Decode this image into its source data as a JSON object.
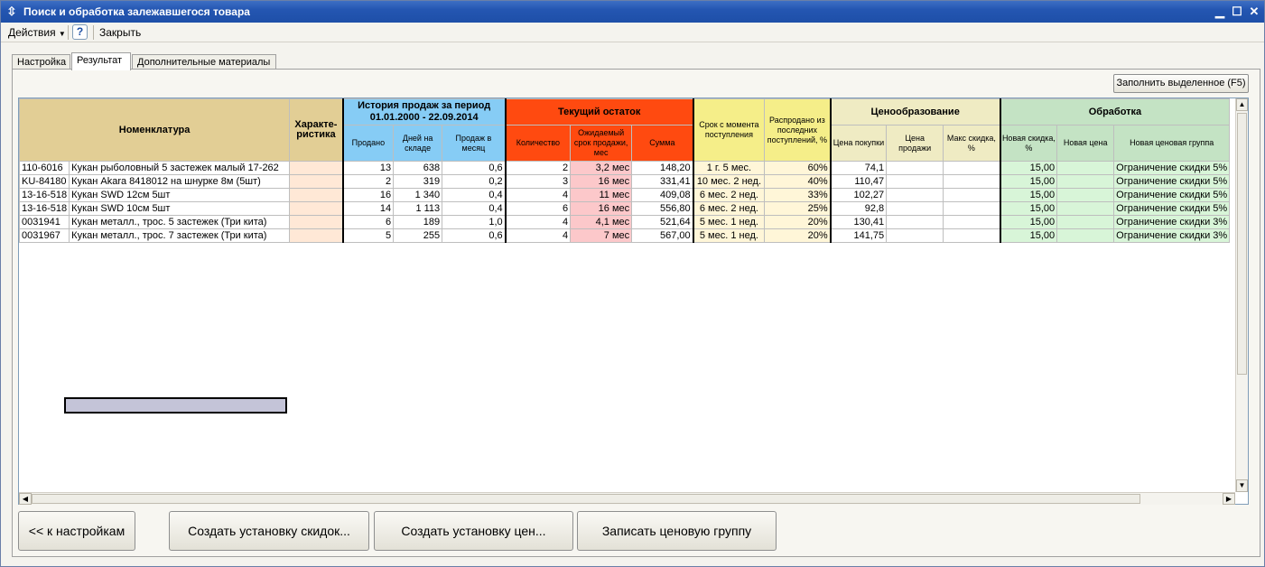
{
  "window": {
    "title": "Поиск и обработка залежавшегося товара"
  },
  "menu": {
    "actions": "Действия",
    "help": "?",
    "close": "Закрыть"
  },
  "tabs": [
    "Настройка",
    "Результат",
    "Дополнительные материалы"
  ],
  "fill_selected_button": "Заполнить выделенное (F5)",
  "table": {
    "group_headers": {
      "nomenclature": "Номенклатура",
      "characteristic": "Характе-\nристика",
      "history": "История продаж за период\n01.01.2000 - 22.09.2014",
      "stock": "Текущий остаток",
      "age": "Срок с момента поступления",
      "sold_percent": "Распродано из последних поступлений, %",
      "pricing": "Ценообразование",
      "processing": "Обработка"
    },
    "sub_headers": {
      "sold": "Продано",
      "days_in_stock": "Дней на складе",
      "sales_per_month": "Продаж в месяц",
      "quantity": "Количество",
      "expected_term": "Ожидаемый срок продажи, мес",
      "sum": "Сумма",
      "purchase_price": "Цена покупки",
      "sale_price": "Цена продажи",
      "max_discount": "Макс скидка, %",
      "new_discount": "Новая скидка, %",
      "new_price": "Новая цена",
      "new_price_group": "Новая ценовая группа"
    },
    "rows": [
      {
        "code": "110-6016",
        "name": "Кукан рыболовный 5 застежек малый 17-262",
        "char": "",
        "sold": "13",
        "days": "638",
        "per_month": "0,6",
        "qty": "2",
        "expected": "3,2 мес",
        "sum": "148,20",
        "age": "1 г. 5 мес.",
        "sold_pct": "60%",
        "purchase": "74,1",
        "sale": "",
        "max_disc": "",
        "new_disc": "15,00",
        "new_price": "",
        "group": "Ограничение скидки 5%"
      },
      {
        "code": "KU-84180",
        "name": "Кукан Akara 8418012 на шнурке 8м (5шт)",
        "char": "",
        "sold": "2",
        "days": "319",
        "per_month": "0,2",
        "qty": "3",
        "expected": "16 мес",
        "sum": "331,41",
        "age": "10 мес. 2 нед.",
        "sold_pct": "40%",
        "purchase": "110,47",
        "sale": "",
        "max_disc": "",
        "new_disc": "15,00",
        "new_price": "",
        "group": "Ограничение скидки 5%"
      },
      {
        "code": "13-16-518",
        "name": "Кукан SWD 12см 5шт",
        "char": "",
        "sold": "16",
        "days": "1 340",
        "per_month": "0,4",
        "qty": "4",
        "expected": "11 мес",
        "sum": "409,08",
        "age": "6 мес. 2 нед.",
        "sold_pct": "33%",
        "purchase": "102,27",
        "sale": "",
        "max_disc": "",
        "new_disc": "15,00",
        "new_price": "",
        "group": "Ограничение скидки 5%"
      },
      {
        "code": "13-16-518",
        "name": "Кукан SWD 10см 5шт",
        "char": "",
        "sold": "14",
        "days": "1 113",
        "per_month": "0,4",
        "qty": "6",
        "expected": "16 мес",
        "sum": "556,80",
        "age": "6 мес. 2 нед.",
        "sold_pct": "25%",
        "purchase": "92,8",
        "sale": "",
        "max_disc": "",
        "new_disc": "15,00",
        "new_price": "",
        "group": "Ограничение скидки 5%"
      },
      {
        "code": "0031941",
        "name": "Кукан металл., трос. 5 застежек (Три кита)",
        "char": "",
        "sold": "6",
        "days": "189",
        "per_month": "1,0",
        "qty": "4",
        "expected": "4,1 мес",
        "sum": "521,64",
        "age": "5 мес. 1 нед.",
        "sold_pct": "20%",
        "purchase": "130,41",
        "sale": "",
        "max_disc": "",
        "new_disc": "15,00",
        "new_price": "",
        "group": "Ограничение скидки 3%"
      },
      {
        "code": "0031967",
        "name": "Кукан металл., трос. 7 застежек (Три кита)",
        "char": "",
        "sold": "5",
        "days": "255",
        "per_month": "0,6",
        "qty": "4",
        "expected": "7 мес",
        "sum": "567,00",
        "age": "5 мес. 1 нед.",
        "sold_pct": "20%",
        "purchase": "141,75",
        "sale": "",
        "max_disc": "",
        "new_disc": "15,00",
        "new_price": "",
        "group": "Ограничение скидки 3%"
      }
    ]
  },
  "buttons": {
    "back": "<< к настройкам",
    "create_discounts": "Создать установку скидок...",
    "create_prices": "Создать установку цен...",
    "write_price_group": "Записать ценовую группу"
  },
  "colors": {
    "nomenclature": "#E2CE95",
    "history": "#86CCF5",
    "stock": "#FF4A10",
    "age": "#F5EE89",
    "pricing": "#EFEBC3",
    "processing": "#C4E3C4",
    "title_bar": "#2456B2"
  }
}
